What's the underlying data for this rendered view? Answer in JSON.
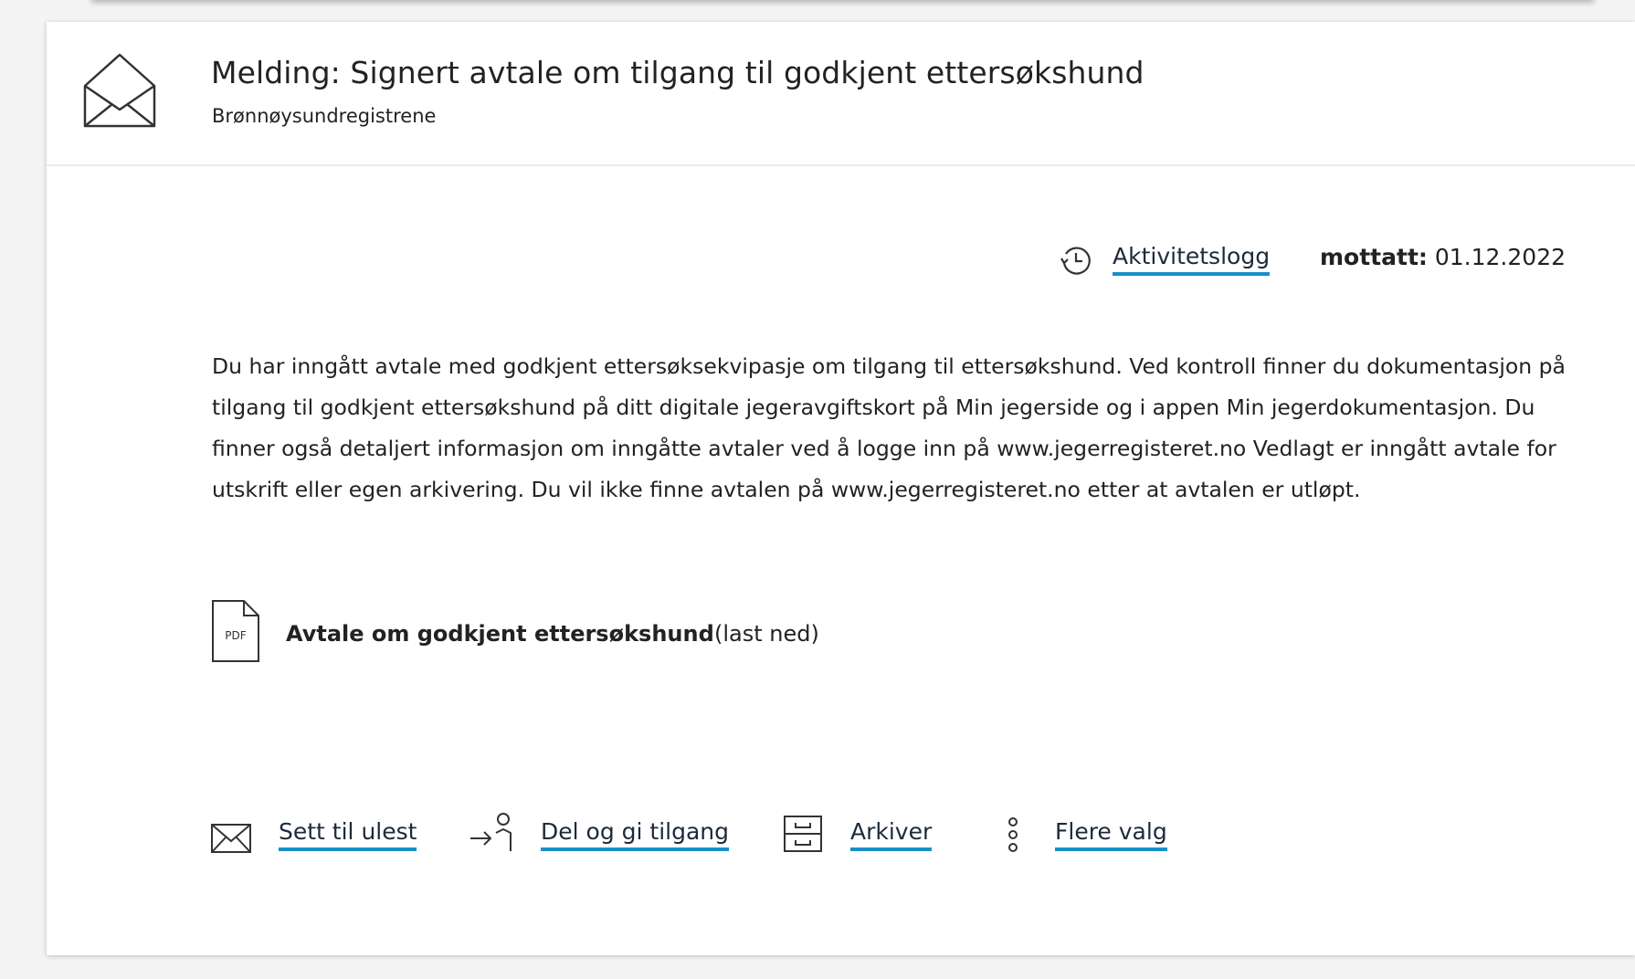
{
  "message": {
    "title": "Melding: Signert avtale om tilgang til godkjent ettersøkshund",
    "sender": "Brønnøysundregistrene",
    "activity_log_label": "Aktivitetslogg",
    "received_label": "mottatt:",
    "received_date": "01.12.2022",
    "body": "Du har inngått avtale med godkjent ettersøksekvipasje om tilgang til ettersøkshund. Ved kontroll finner du dokumentasjon på tilgang til godkjent ettersøkshund på ditt digitale jegeravgiftskort på Min jegerside og i appen Min jegerdokumentasjon. Du finner også detaljert informasjon om inngåtte avtaler ved å logge inn på www.jegerregisteret.no Vedlagt er inngått avtale for utskrift eller egen arkivering. Du vil ikke finne avtalen på www.jegerregisteret.no etter at avtalen er utløpt."
  },
  "attachment": {
    "icon_label": "PDF",
    "name": "Avtale om godkjent ettersøkshund",
    "download_label": "(last ned)"
  },
  "actions": [
    {
      "label": "Sett til ulest",
      "icon": "envelope-icon"
    },
    {
      "label": "Del og gi tilgang",
      "icon": "share-person-icon"
    },
    {
      "label": "Arkiver",
      "icon": "archive-icon"
    },
    {
      "label": "Flere valg",
      "icon": "more-options-icon"
    }
  ],
  "colors": {
    "link_underline": "#1a8fc9",
    "page_background": "#f4f4f4",
    "card_background": "#ffffff"
  }
}
